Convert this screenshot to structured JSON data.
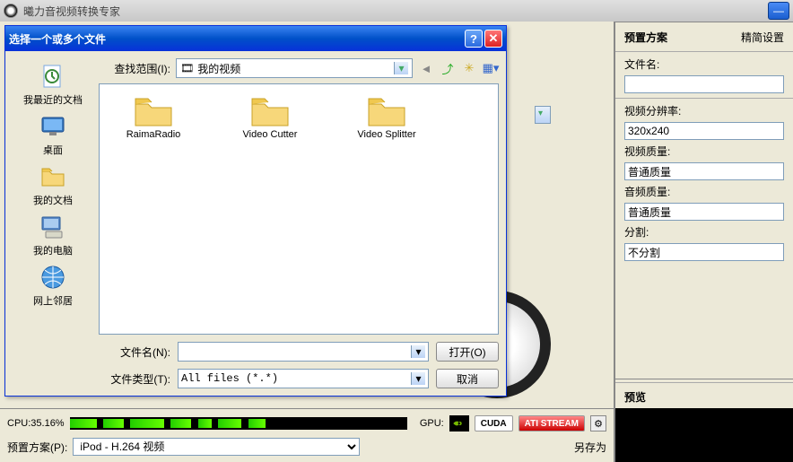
{
  "app": {
    "title": "曦力音视频转换专家"
  },
  "right": {
    "heading": "预置方案",
    "advanced": "精简设置",
    "filename_label": "文件名:",
    "res_label": "视频分辨率:",
    "res_value": "320x240",
    "vq_label": "视频质量:",
    "vq_value": "普通质量",
    "aq_label": "音频质量:",
    "aq_value": "普通质量",
    "split_label": "分割:",
    "split_value": "不分割",
    "preview_label": "预览"
  },
  "bottom": {
    "cpu_label": "CPU:35.16%",
    "gpu_label": "GPU:",
    "cuda": "CUDA",
    "ati": "ATI STREAM",
    "preset_label": "预置方案(P):",
    "preset_value": "iPod - H.264 视频",
    "saveas_label": "另存为"
  },
  "dialog": {
    "title": "选择一个或多个文件",
    "lookin_label": "查找范围(I):",
    "lookin_value": "我的视频",
    "filename_label": "文件名(N):",
    "filetype_label": "文件类型(T):",
    "filetype_value": "All files (*.*)",
    "open_btn": "打开(O)",
    "cancel_btn": "取消",
    "sidebar": {
      "recent": "我最近的文档",
      "desktop": "桌面",
      "mydocs": "我的文档",
      "mycomputer": "我的电脑",
      "network": "网上邻居"
    },
    "folders": [
      "RaimaRadio",
      "Video Cutter",
      "Video Splitter"
    ]
  }
}
